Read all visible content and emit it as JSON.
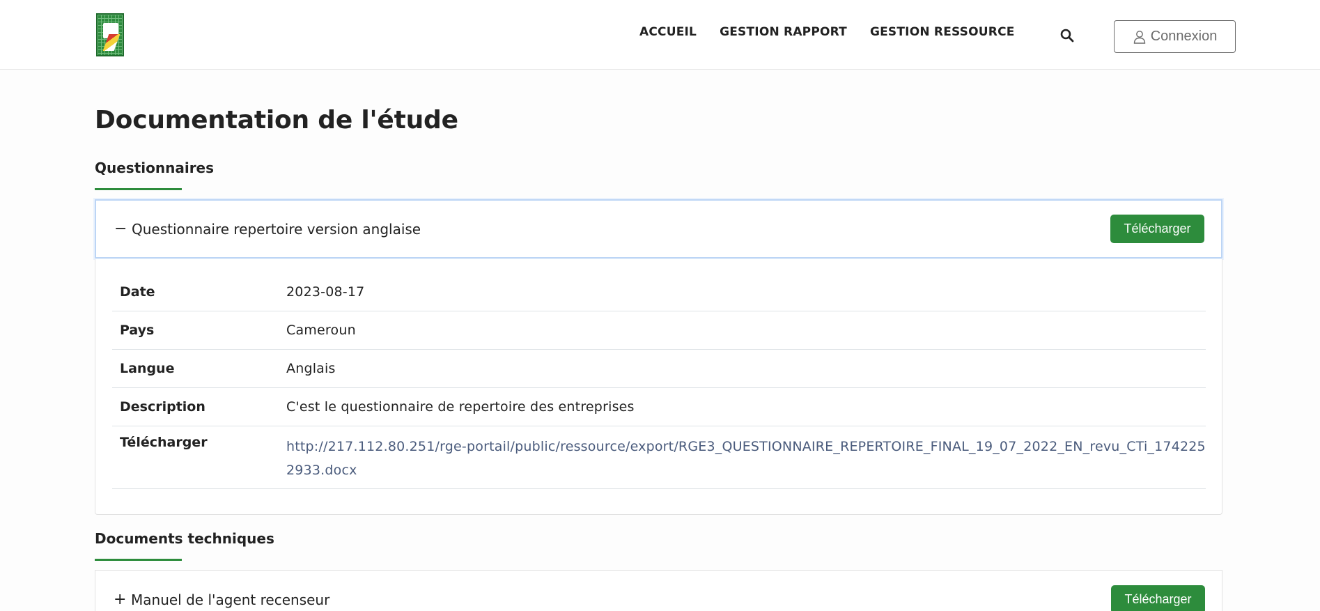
{
  "header": {
    "nav": [
      "ACCUEIL",
      "GESTION RAPPORT",
      "GESTION RESSOURCE"
    ],
    "login_label": "Connexion"
  },
  "page": {
    "title": "Documentation de l'étude"
  },
  "sections": {
    "questionnaires": {
      "title": "Questionnaires",
      "item": {
        "sign": "−",
        "title": "Questionnaire repertoire version anglaise",
        "download_label": "Télécharger",
        "rows": [
          {
            "key": "Date",
            "value": "2023-08-17"
          },
          {
            "key": "Pays",
            "value": "Cameroun"
          },
          {
            "key": "Langue",
            "value": "Anglais"
          },
          {
            "key": "Description",
            "value": "C'est le questionnaire de repertoire des entreprises"
          },
          {
            "key": "Télécharger",
            "value": "http://217.112.80.251/rge-portail/public/ressource/export/RGE3_QUESTIONNAIRE_REPERTOIRE_FINAL_19_07_2022_EN_revu_CTi_1742252933.docx"
          }
        ]
      }
    },
    "documents": {
      "title": "Documents techniques",
      "item": {
        "sign": "+",
        "title": "Manuel de l'agent recenseur",
        "download_label": "Télécharger"
      }
    }
  },
  "colors": {
    "accent": "#2d8c3c",
    "link": "#4a5b7c",
    "active_border": "#bcd5f5"
  }
}
